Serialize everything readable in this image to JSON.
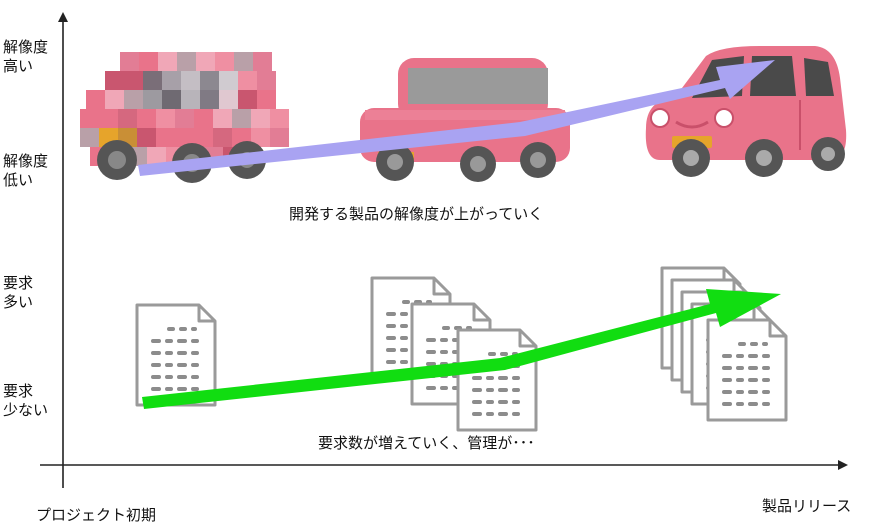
{
  "axes": {
    "y_top_high": "解像度\n高い",
    "y_top_low": "解像度\n低い",
    "y_bottom_high": "要求\n多い",
    "y_bottom_low": "要求\n少ない",
    "x_start": "プロジェクト初期",
    "x_end": "製品リリース"
  },
  "captions": {
    "resolution": "開発する製品の解像度が上がっていく",
    "requirements": "要求数が増えていく、管理が･･･"
  },
  "colors": {
    "car_body": "#e9738a",
    "car_dark": "#c9506a",
    "tire": "#555555",
    "resolution_arrow": "#a9a3f2",
    "requirements_arrow": "#11dd11",
    "doc_outline": "#9a9a9a"
  },
  "illustrations": {
    "cars": [
      "car-pixelated-heavy",
      "car-pixelated-light",
      "car-clear"
    ],
    "document_stacks": [
      1,
      3,
      5
    ]
  }
}
